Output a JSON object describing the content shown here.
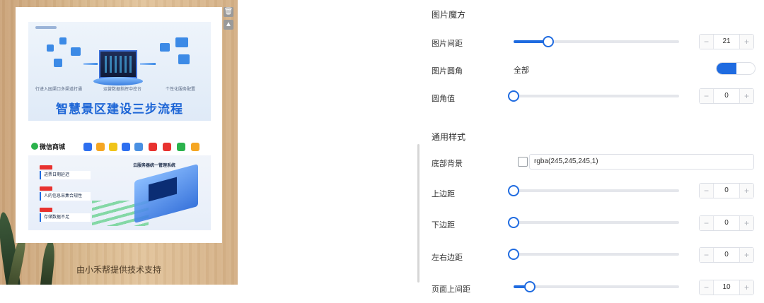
{
  "preview": {
    "image1": {
      "captions": [
        "行进入园渠口多渠道打通",
        "运营数据指挥中控台",
        "个性化服务配置"
      ],
      "title": "智慧景区建设三步流程"
    },
    "image2": {
      "brand": "微信商城",
      "system_title": "云服务器统一管理系统",
      "tags": [
        "进票日期延迟",
        "人的信息采集合规性",
        "存储数据不足"
      ]
    },
    "credit": "由小禾帮提供技术支持"
  },
  "panel": {
    "section1_title": "图片魔方",
    "section2_title": "通用样式",
    "rows": {
      "image_spacing": {
        "label": "图片间距",
        "value": "21",
        "fraction": 0.21
      },
      "image_radius": {
        "label": "图片圆角",
        "option": "全部"
      },
      "radius_value": {
        "label": "圆角值",
        "value": "0",
        "fraction": 0
      },
      "bottom_bg": {
        "label": "底部背景",
        "color": "rgba(245,245,245,1)"
      },
      "margin_top": {
        "label": "上边距",
        "value": "0",
        "fraction": 0
      },
      "margin_bottom": {
        "label": "下边距",
        "value": "0",
        "fraction": 0
      },
      "margin_lr": {
        "label": "左右边距",
        "value": "0",
        "fraction": 0
      },
      "page_top_spacing": {
        "label": "页面上间距",
        "value": "10",
        "fraction": 0.1
      }
    },
    "stepper_minus": "−",
    "stepper_plus": "+"
  },
  "colors": {
    "accent": "#1f6be0"
  }
}
